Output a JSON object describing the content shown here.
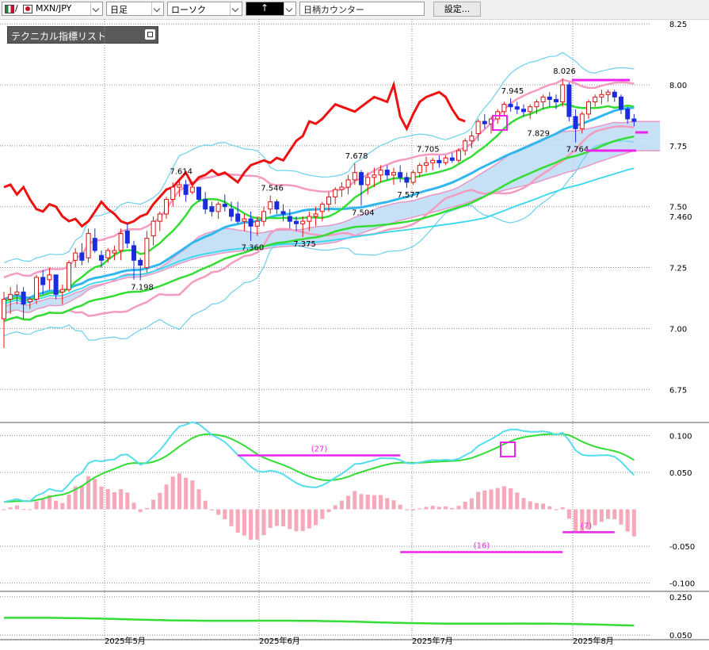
{
  "toolbar": {
    "symbol": "MXN/JPY",
    "timeframe": "日足",
    "chart_style": "ローソク",
    "pointer_glyph": "↑",
    "counter_placeholder": "日柄カウンター",
    "settings_label": "設定..."
  },
  "indicator_panel": {
    "label": "テクニカル指標リスト"
  },
  "colors": {
    "ichimoku_cloud": "#bcdcf4",
    "cloud_bear": "#f8c8d8",
    "span_line": "#e898c4",
    "bollinger_inner": "#f49cc0",
    "bollinger_outer": "#6cd0ec",
    "ma_short": "#33dd33",
    "ma_long": "#30b8ee",
    "ma_teal": "#36d8ee",
    "red_line": "#ee1111",
    "up_candle": "#e01111",
    "down_candle": "#1a2cdd",
    "annotation": "#ee22ee",
    "macd_hist_pos": "#f4a8b8",
    "macd_signal": "#33dd33",
    "macd_line": "#55ddee"
  },
  "chart_data": [
    {
      "type": "candlestick",
      "name": "price",
      "xticks": [
        "2025年5月",
        "2025年6月",
        "2025年7月",
        "2025年8月"
      ],
      "yticks": [
        6.75,
        7.0,
        7.25,
        7.5,
        7.75,
        8.0,
        8.25
      ],
      "ytick_labels": [
        "6.75",
        "7.00",
        "7.25",
        "7.50",
        "7.75",
        "8.00",
        "8.25"
      ],
      "ylim": [
        6.65,
        8.27
      ],
      "price_marker": {
        "value": 7.46,
        "label": "7.460"
      },
      "grid": true,
      "candles": [
        [
          7.04,
          7.15,
          6.92,
          7.12
        ],
        [
          7.12,
          7.17,
          7.06,
          7.14
        ],
        [
          7.14,
          7.18,
          7.1,
          7.15
        ],
        [
          7.15,
          7.17,
          7.04,
          7.1
        ],
        [
          7.11,
          7.13,
          7.08,
          7.12
        ],
        [
          7.12,
          7.22,
          7.1,
          7.21
        ],
        [
          7.21,
          7.24,
          7.14,
          7.18
        ],
        [
          7.2,
          7.25,
          7.16,
          7.22
        ],
        [
          7.22,
          7.22,
          7.12,
          7.14
        ],
        [
          7.15,
          7.18,
          7.1,
          7.16
        ],
        [
          7.16,
          7.28,
          7.15,
          7.27
        ],
        [
          7.28,
          7.33,
          7.25,
          7.31
        ],
        [
          7.31,
          7.35,
          7.26,
          7.28
        ],
        [
          7.29,
          7.41,
          7.27,
          7.39
        ],
        [
          7.37,
          7.41,
          7.31,
          7.32
        ],
        [
          7.3,
          7.32,
          7.25,
          7.28
        ],
        [
          7.29,
          7.33,
          7.27,
          7.32
        ],
        [
          7.31,
          7.34,
          7.28,
          7.32
        ],
        [
          7.32,
          7.41,
          7.28,
          7.39
        ],
        [
          7.4,
          7.43,
          7.33,
          7.35
        ],
        [
          7.34,
          7.36,
          7.2,
          7.28
        ],
        [
          7.28,
          7.29,
          7.198,
          7.26
        ],
        [
          7.25,
          7.4,
          7.23,
          7.37
        ],
        [
          7.38,
          7.46,
          7.34,
          7.44
        ],
        [
          7.44,
          7.48,
          7.4,
          7.47
        ],
        [
          7.47,
          7.54,
          7.45,
          7.53
        ],
        [
          7.53,
          7.6,
          7.5,
          7.58
        ],
        [
          7.58,
          7.614,
          7.54,
          7.59
        ],
        [
          7.59,
          7.61,
          7.52,
          7.55
        ],
        [
          7.56,
          7.6,
          7.55,
          7.58
        ],
        [
          7.58,
          7.58,
          7.52,
          7.53
        ],
        [
          7.53,
          7.56,
          7.47,
          7.49
        ],
        [
          7.5,
          7.52,
          7.46,
          7.48
        ],
        [
          7.48,
          7.52,
          7.45,
          7.51
        ],
        [
          7.51,
          7.55,
          7.48,
          7.5
        ],
        [
          7.49,
          7.52,
          7.44,
          7.46
        ],
        [
          7.47,
          7.52,
          7.43,
          7.44
        ],
        [
          7.44,
          7.47,
          7.4,
          7.45
        ],
        [
          7.45,
          7.48,
          7.36,
          7.42
        ],
        [
          7.42,
          7.46,
          7.38,
          7.44
        ],
        [
          7.44,
          7.5,
          7.42,
          7.48
        ],
        [
          7.49,
          7.546,
          7.47,
          7.52
        ],
        [
          7.52,
          7.53,
          7.47,
          7.49
        ],
        [
          7.48,
          7.51,
          7.44,
          7.47
        ],
        [
          7.46,
          7.49,
          7.41,
          7.44
        ],
        [
          7.44,
          7.46,
          7.4,
          7.43
        ],
        [
          7.43,
          7.46,
          7.375,
          7.44
        ],
        [
          7.44,
          7.48,
          7.4,
          7.46
        ],
        [
          7.46,
          7.5,
          7.42,
          7.47
        ],
        [
          7.48,
          7.52,
          7.44,
          7.51
        ],
        [
          7.51,
          7.56,
          7.48,
          7.54
        ],
        [
          7.54,
          7.58,
          7.51,
          7.57
        ],
        [
          7.57,
          7.6,
          7.54,
          7.58
        ],
        [
          7.58,
          7.63,
          7.55,
          7.61
        ],
        [
          7.61,
          7.678,
          7.59,
          7.64
        ],
        [
          7.64,
          7.65,
          7.504,
          7.59
        ],
        [
          7.59,
          7.64,
          7.55,
          7.62
        ],
        [
          7.62,
          7.66,
          7.58,
          7.63
        ],
        [
          7.63,
          7.67,
          7.6,
          7.65
        ],
        [
          7.65,
          7.67,
          7.61,
          7.63
        ],
        [
          7.63,
          7.66,
          7.59,
          7.64
        ],
        [
          7.64,
          7.67,
          7.6,
          7.62
        ],
        [
          7.62,
          7.64,
          7.577,
          7.6
        ],
        [
          7.6,
          7.65,
          7.59,
          7.64
        ],
        [
          7.64,
          7.68,
          7.62,
          7.67
        ],
        [
          7.67,
          7.705,
          7.64,
          7.68
        ],
        [
          7.68,
          7.7,
          7.65,
          7.69
        ],
        [
          7.69,
          7.71,
          7.66,
          7.68
        ],
        [
          7.68,
          7.71,
          7.67,
          7.7
        ],
        [
          7.7,
          7.72,
          7.68,
          7.69
        ],
        [
          7.69,
          7.74,
          7.68,
          7.73
        ],
        [
          7.73,
          7.78,
          7.71,
          7.77
        ],
        [
          7.77,
          7.81,
          7.74,
          7.79
        ],
        [
          7.8,
          7.86,
          7.77,
          7.85
        ],
        [
          7.85,
          7.88,
          7.82,
          7.84
        ],
        [
          7.84,
          7.87,
          7.8,
          7.86
        ],
        [
          7.86,
          7.9,
          7.84,
          7.89
        ],
        [
          7.89,
          7.93,
          7.87,
          7.92
        ],
        [
          7.92,
          7.945,
          7.89,
          7.91
        ],
        [
          7.91,
          7.93,
          7.88,
          7.9
        ],
        [
          7.9,
          7.92,
          7.87,
          7.89
        ],
        [
          7.89,
          7.92,
          7.86,
          7.91
        ],
        [
          7.91,
          7.94,
          7.88,
          7.93
        ],
        [
          7.93,
          7.96,
          7.9,
          7.95
        ],
        [
          7.95,
          7.97,
          7.91,
          7.94
        ],
        [
          7.94,
          7.96,
          7.9,
          7.93
        ],
        [
          7.93,
          8.026,
          7.91,
          8.0
        ],
        [
          8.0,
          8.01,
          7.85,
          7.87
        ],
        [
          7.87,
          7.9,
          7.764,
          7.82
        ],
        [
          7.82,
          7.89,
          7.8,
          7.88
        ],
        [
          7.88,
          7.94,
          7.86,
          7.93
        ],
        [
          7.93,
          7.96,
          7.91,
          7.95
        ],
        [
          7.95,
          7.98,
          7.92,
          7.96
        ],
        [
          7.96,
          7.98,
          7.93,
          7.97
        ],
        [
          7.97,
          7.98,
          7.93,
          7.95
        ],
        [
          7.95,
          7.96,
          7.88,
          7.9
        ],
        [
          7.9,
          7.91,
          7.84,
          7.86
        ],
        [
          7.86,
          7.88,
          7.83,
          7.85
        ]
      ],
      "price_labels": [
        {
          "index": 21,
          "value": 7.198,
          "label": "7.198",
          "pos": "below"
        },
        {
          "index": 27,
          "value": 7.614,
          "label": "7.614",
          "pos": "above"
        },
        {
          "index": 38,
          "value": 7.36,
          "label": "7.360",
          "pos": "below"
        },
        {
          "index": 41,
          "value": 7.546,
          "label": "7.546",
          "pos": "above"
        },
        {
          "index": 46,
          "value": 7.375,
          "label": "7.375",
          "pos": "below"
        },
        {
          "index": 54,
          "value": 7.678,
          "label": "7.678",
          "pos": "above"
        },
        {
          "index": 55,
          "value": 7.504,
          "label": "7.504",
          "pos": "below"
        },
        {
          "index": 62,
          "value": 7.577,
          "label": "7.577",
          "pos": "below"
        },
        {
          "index": 65,
          "value": 7.705,
          "label": "7.705",
          "pos": "above"
        },
        {
          "index": 78,
          "value": 7.945,
          "label": "7.945",
          "pos": "above"
        },
        {
          "index": 82,
          "value": 7.829,
          "label": "7.829",
          "pos": "below"
        },
        {
          "index": 86,
          "value": 8.026,
          "label": "8.026",
          "pos": "above"
        },
        {
          "index": 88,
          "value": 7.764,
          "label": "7.764",
          "pos": "below"
        }
      ]
    },
    {
      "type": "bar+line",
      "name": "macd",
      "yticks": [
        -0.1,
        -0.05,
        0.05,
        0.1
      ],
      "ytick_labels": [
        "-0.100",
        "-0.050",
        "0.050",
        "0.100"
      ],
      "ylim": [
        -0.11,
        0.11
      ],
      "annotations": [
        {
          "label": "(27)",
          "from": 36,
          "to": 61,
          "value": 0.073
        },
        {
          "label": "(16)",
          "from": 61,
          "to": 86,
          "value": -0.058
        },
        {
          "label": "(7)",
          "from": 86,
          "to": 94,
          "value": -0.031
        }
      ]
    },
    {
      "type": "line",
      "name": "sub-indicator",
      "yticks": [
        0.05,
        0.25
      ],
      "ytick_labels": [
        "0.050",
        "0.250"
      ],
      "ylim": [
        0.03,
        0.27
      ]
    }
  ]
}
